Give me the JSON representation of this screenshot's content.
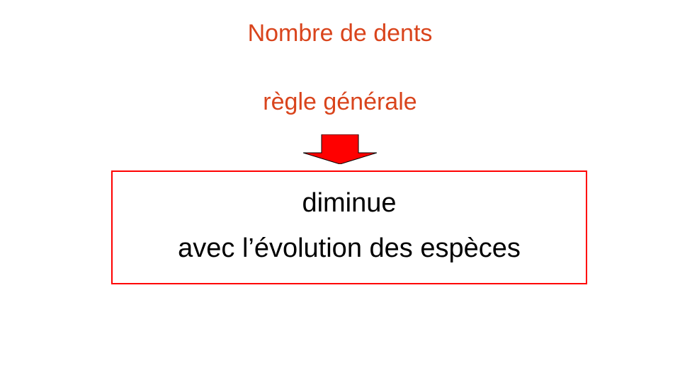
{
  "slide": {
    "title": "Nombre de dents",
    "subtitle": "règle générale",
    "box": {
      "line1": "diminue",
      "line2": "avec l’évolution des espèces"
    }
  },
  "colors": {
    "heading": "#d9441c",
    "arrow_fill": "#ff0000",
    "box_border": "#ff0000",
    "box_text": "#000000",
    "background": "#ffffff"
  },
  "icons": {
    "arrow": "down-arrow-icon"
  }
}
